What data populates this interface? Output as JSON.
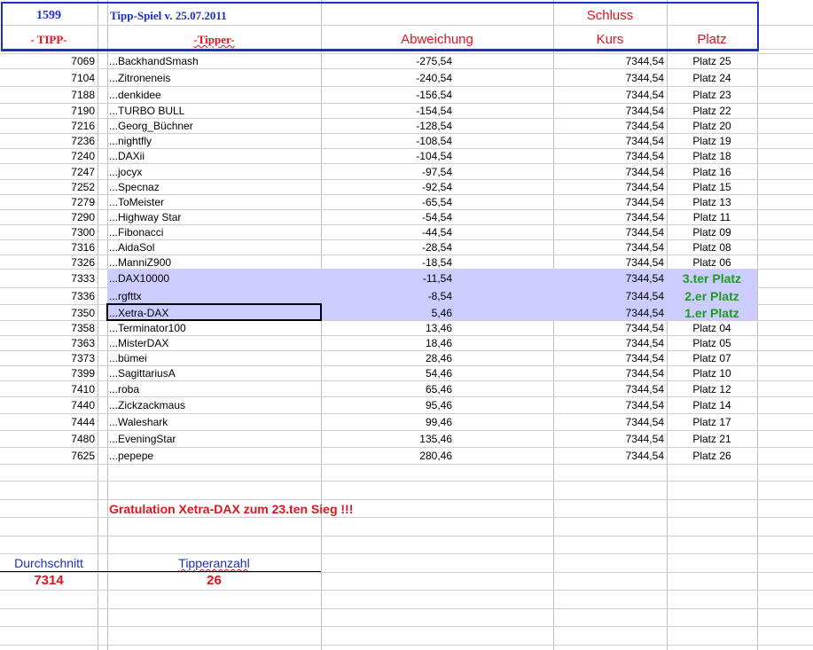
{
  "header": {
    "id": "1599",
    "title": "Tipp-Spiel v. 25.07.2011",
    "schluss": "Schluss",
    "col_tipp": "- TIPP-",
    "col_tipper": "-Tipper-",
    "col_abweichung": "Abweichung",
    "col_kurs": "Kurs",
    "col_platz": "Platz"
  },
  "rows": [
    {
      "tipp": "7069",
      "tipper": "...BackhandSmash",
      "abw": "-275,54",
      "kurs": "7344,54",
      "platz": "Platz 25"
    },
    {
      "tipp": "7104",
      "tipper": "...Zitroneneis",
      "abw": "-240,54",
      "kurs": "7344,54",
      "platz": "Platz 24"
    },
    {
      "tipp": "7188",
      "tipper": "...denkidee",
      "abw": "-156,54",
      "kurs": "7344,54",
      "platz": "Platz 23"
    },
    {
      "tipp": "7190",
      "tipper": "...TURBO BULL",
      "abw": "-154,54",
      "kurs": "7344,54",
      "platz": "Platz 22"
    },
    {
      "tipp": "7216",
      "tipper": "...Georg_Büchner",
      "abw": "-128,54",
      "kurs": "7344,54",
      "platz": "Platz 20"
    },
    {
      "tipp": "7236",
      "tipper": "...nightfly",
      "abw": "-108,54",
      "kurs": "7344,54",
      "platz": "Platz 19"
    },
    {
      "tipp": "7240",
      "tipper": "...DAXii",
      "abw": "-104,54",
      "kurs": "7344,54",
      "platz": "Platz 18"
    },
    {
      "tipp": "7247",
      "tipper": "...jocyx",
      "abw": "-97,54",
      "kurs": "7344,54",
      "platz": "Platz 16"
    },
    {
      "tipp": "7252",
      "tipper": "...Specnaz",
      "abw": "-92,54",
      "kurs": "7344,54",
      "platz": "Platz 15"
    },
    {
      "tipp": "7279",
      "tipper": "...ToMeister",
      "abw": "-65,54",
      "kurs": "7344,54",
      "platz": "Platz 13"
    },
    {
      "tipp": "7290",
      "tipper": "...Highway Star",
      "abw": "-54,54",
      "kurs": "7344,54",
      "platz": "Platz 11"
    },
    {
      "tipp": "7300",
      "tipper": "...Fibonacci",
      "abw": "-44,54",
      "kurs": "7344,54",
      "platz": "Platz 09"
    },
    {
      "tipp": "7316",
      "tipper": "...AidaSol",
      "abw": "-28,54",
      "kurs": "7344,54",
      "platz": "Platz 08"
    },
    {
      "tipp": "7326",
      "tipper": "...ManniZ900",
      "abw": "-18,54",
      "kurs": "7344,54",
      "platz": "Platz 06"
    },
    {
      "tipp": "7333",
      "tipper": "...DAX10000",
      "abw": "-11,54",
      "kurs": "7344,54",
      "platz": "3.ter Platz",
      "top": true
    },
    {
      "tipp": "7336",
      "tipper": "...rgfttx",
      "abw": "-8,54",
      "kurs": "7344,54",
      "platz": "2.er Platz",
      "top": true
    },
    {
      "tipp": "7350",
      "tipper": "...Xetra-DAX",
      "abw": "5,46",
      "kurs": "7344,54",
      "platz": "1.er Platz",
      "top": true
    },
    {
      "tipp": "7358",
      "tipper": "...Terminator100",
      "abw": "13,46",
      "kurs": "7344,54",
      "platz": "Platz 04"
    },
    {
      "tipp": "7363",
      "tipper": "...MisterDAX",
      "abw": "18,46",
      "kurs": "7344,54",
      "platz": "Platz 05"
    },
    {
      "tipp": "7373",
      "tipper": "...bümei",
      "abw": "28,46",
      "kurs": "7344,54",
      "platz": "Platz 07"
    },
    {
      "tipp": "7399",
      "tipper": "...SagittariusA",
      "abw": "54,46",
      "kurs": "7344,54",
      "platz": "Platz 10"
    },
    {
      "tipp": "7410",
      "tipper": "...roba",
      "abw": "65,46",
      "kurs": "7344,54",
      "platz": "Platz 12"
    },
    {
      "tipp": "7440",
      "tipper": "...Zickzackmaus",
      "abw": "95,46",
      "kurs": "7344,54",
      "platz": "Platz 14"
    },
    {
      "tipp": "7444",
      "tipper": "...Waleshark",
      "abw": "99,46",
      "kurs": "7344,54",
      "platz": "Platz 17"
    },
    {
      "tipp": "7480",
      "tipper": "...EveningStar",
      "abw": "135,46",
      "kurs": "7344,54",
      "platz": "Platz 21"
    },
    {
      "tipp": "7625",
      "tipper": "...pepepe",
      "abw": "280,46",
      "kurs": "7344,54",
      "platz": "Platz 26"
    }
  ],
  "footer": {
    "gratulation": "Gratulation Xetra-DAX  zum   23.ten Sieg !!!",
    "durchschnitt_label": "Durchschnitt",
    "durchschnitt": "7314",
    "tipperanzahl_label": "Tipperanzahl",
    "tipperanzahl": "26"
  }
}
